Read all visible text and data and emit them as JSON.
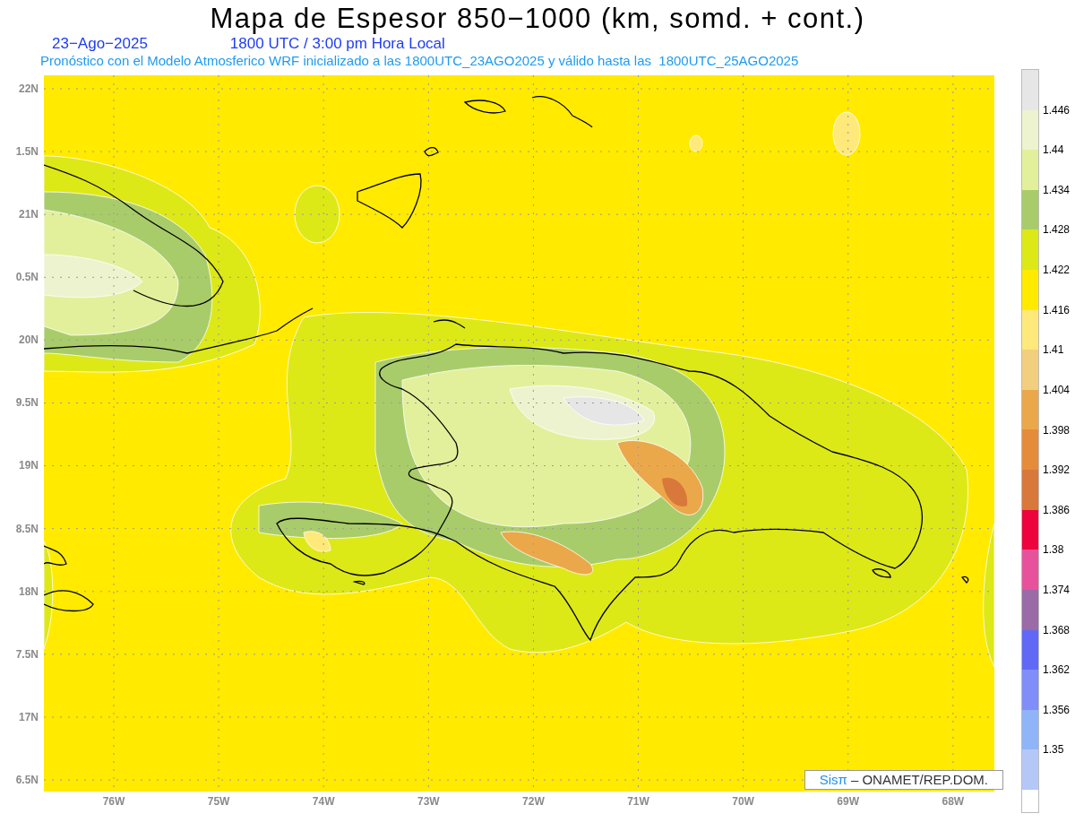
{
  "header": {
    "title": "Mapa de Espesor 850−1000 (km, somd. + cont.)",
    "date": "23−Ago−2025",
    "time": "1800 UTC / 3:00 pm Hora Local",
    "subtitle": "Pronóstico con el Modelo Atmosferico WRF inicializado a las 1800UTC_23AGO2025 y válido hasta las  1800UTC_25AGO2025"
  },
  "map": {
    "y_ticks": [
      "22N",
      "1.5N",
      "21N",
      "0.5N",
      "20N",
      "9.5N",
      "19N",
      "8.5N",
      "18N",
      "7.5N",
      "17N",
      "6.5N"
    ],
    "x_ticks": [
      "76W",
      "75W",
      "74W",
      "73W",
      "72W",
      "71W",
      "70W",
      "69W",
      "68W"
    ],
    "credit": {
      "logo": "Sisπ",
      "text": "–  ONAMET/REP.DOM."
    }
  },
  "colorbar": {
    "swatches": [
      {
        "color": "#e6e6e6"
      },
      {
        "color": "#eef3cf"
      },
      {
        "color": "#e2f09c"
      },
      {
        "color": "#a9cc6a"
      },
      {
        "color": "#dde817"
      },
      {
        "color": "#ffea00"
      },
      {
        "color": "#ffe97a"
      },
      {
        "color": "#f2cf7e"
      },
      {
        "color": "#eba84a"
      },
      {
        "color": "#e58c3a"
      },
      {
        "color": "#d8783a"
      },
      {
        "color": "#ee043c"
      },
      {
        "color": "#e7529d"
      },
      {
        "color": "#9a6ba6"
      },
      {
        "color": "#5f69f6"
      },
      {
        "color": "#7f8ef8"
      },
      {
        "color": "#8fb4f8"
      },
      {
        "color": "#b4c8f8"
      }
    ],
    "labels": [
      "1.446",
      "1.44",
      "1.434",
      "1.428",
      "1.422",
      "1.416",
      "1.41",
      "1.404",
      "1.398",
      "1.392",
      "1.386",
      "1.38",
      "1.374",
      "1.368",
      "1.362",
      "1.356",
      "1.35"
    ]
  }
}
